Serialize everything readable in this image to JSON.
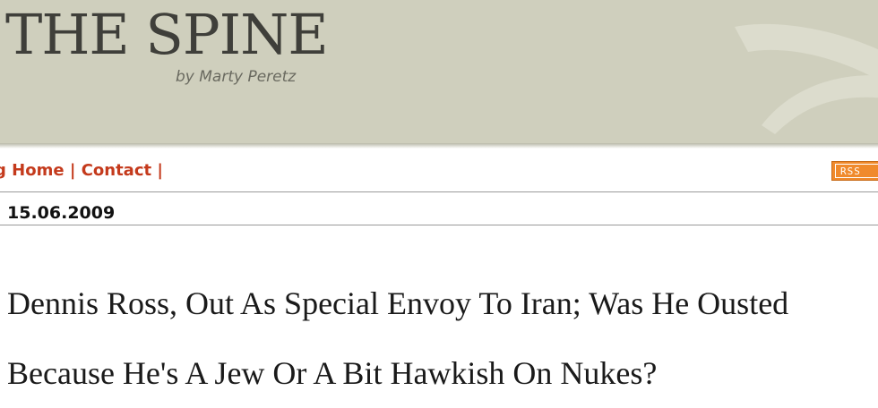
{
  "header": {
    "title": "THE SPINE",
    "byline": "by Marty Peretz"
  },
  "nav": {
    "items": [
      {
        "label": "g Home"
      },
      {
        "label": "Contact"
      }
    ],
    "separator": "|",
    "rss_label": "RSS"
  },
  "post": {
    "date": "15.06.2009",
    "title_line_1": "Dennis Ross, Out As Special Envoy To Iran; Was He Ousted",
    "title_line_2": "Because He's A Jew Or A Bit Hawkish On Nukes?"
  },
  "colors": {
    "header_bg": "#cfcfbd",
    "nav_link": "#c43a1c",
    "rss": "#f08a2c"
  }
}
